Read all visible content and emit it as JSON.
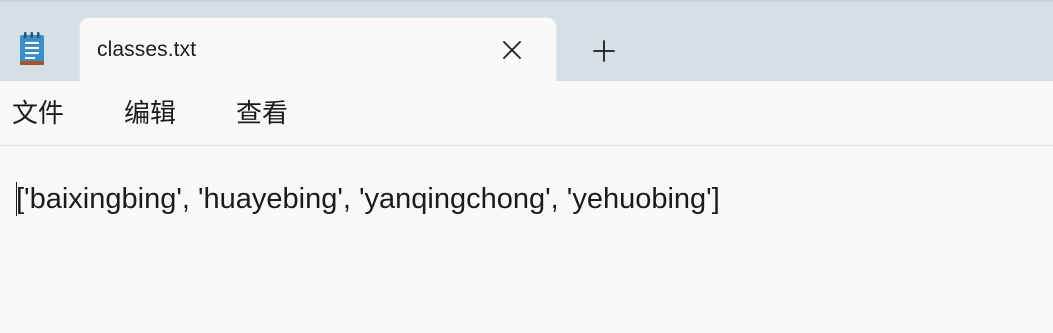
{
  "app": {
    "icon": "notepad-icon"
  },
  "tab": {
    "title": "classes.txt",
    "close_icon": "close-icon"
  },
  "new_tab": {
    "icon": "plus-icon"
  },
  "menu": {
    "items": [
      {
        "label": "文件"
      },
      {
        "label": "编辑"
      },
      {
        "label": "查看"
      }
    ]
  },
  "editor": {
    "content": "['baixingbing', 'huayebing', 'yanqingchong', 'yehuobing']"
  },
  "colors": {
    "tabstrip_bg": "#d4e0e6",
    "window_bg": "#f9f9f9",
    "text": "#1b1b1b",
    "icon_blue": "#3a8fc9"
  }
}
